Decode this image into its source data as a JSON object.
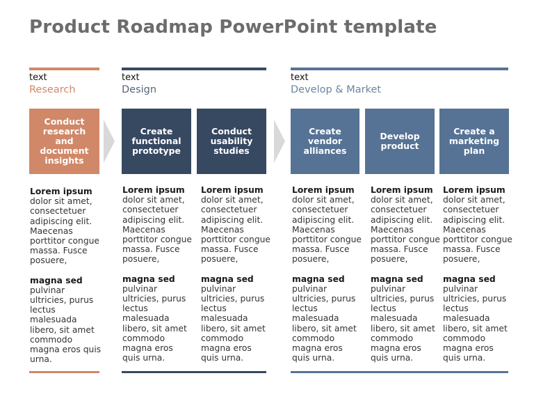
{
  "title": "Product Roadmap PowerPoint template",
  "colors": {
    "research": "#d08868",
    "design": "#374861",
    "develop": "#567395",
    "arrow": "#d9d9d9",
    "title": "#6d6b6c"
  },
  "phases": [
    {
      "small_label": "text",
      "name": "Research",
      "steps": [
        {
          "box_label": "Conduct research and document insights",
          "heading1": "Lorem ipsum",
          "body1": "dolor sit amet, consectetuer adipiscing elit. Maecenas porttitor congue massa. Fusce posuere,",
          "heading2": "magna sed",
          "body2": "pulvinar ultricies, purus lectus malesuada libero, sit amet commodo magna eros quis urna."
        }
      ]
    },
    {
      "small_label": "text",
      "name": "Design",
      "steps": [
        {
          "box_label": "Create functional prototype",
          "heading1": "Lorem ipsum",
          "body1": "dolor sit amet, consectetuer adipiscing elit. Maecenas porttitor congue massa. Fusce posuere,",
          "heading2": "magna sed",
          "body2": "pulvinar ultricies, purus lectus malesuada libero, sit amet commodo magna eros quis urna."
        },
        {
          "box_label": "Conduct usability studies",
          "heading1": "Lorem ipsum",
          "body1": "dolor sit amet, consectetuer adipiscing elit. Maecenas porttitor congue massa. Fusce posuere,",
          "heading2": "magna sed",
          "body2": "pulvinar ultricies, purus lectus malesuada libero, sit amet commodo magna eros quis urna."
        }
      ]
    },
    {
      "small_label": "text",
      "name": "Develop & Market",
      "steps": [
        {
          "box_label": "Create vendor alliances",
          "heading1": "Lorem ipsum",
          "body1": "dolor sit amet, consectetuer adipiscing elit. Maecenas porttitor congue massa. Fusce posuere,",
          "heading2": "magna sed",
          "body2": "pulvinar ultricies, purus lectus malesuada libero, sit amet commodo magna eros quis urna."
        },
        {
          "box_label": "Develop product",
          "heading1": "Lorem ipsum",
          "body1": "dolor sit amet, consectetuer adipiscing elit. Maecenas porttitor congue massa. Fusce posuere,",
          "heading2": "magna sed",
          "body2": "pulvinar ultricies, purus lectus malesuada libero, sit amet commodo magna eros quis urna."
        },
        {
          "box_label": "Create a marketing plan",
          "heading1": "Lorem ipsum",
          "body1": "dolor sit amet, consectetuer adipiscing elit. Maecenas porttitor congue massa. Fusce posuere,",
          "heading2": "magna sed",
          "body2": "pulvinar ultricies, purus lectus malesuada libero, sit amet commodo magna eros quis urna."
        }
      ]
    }
  ]
}
